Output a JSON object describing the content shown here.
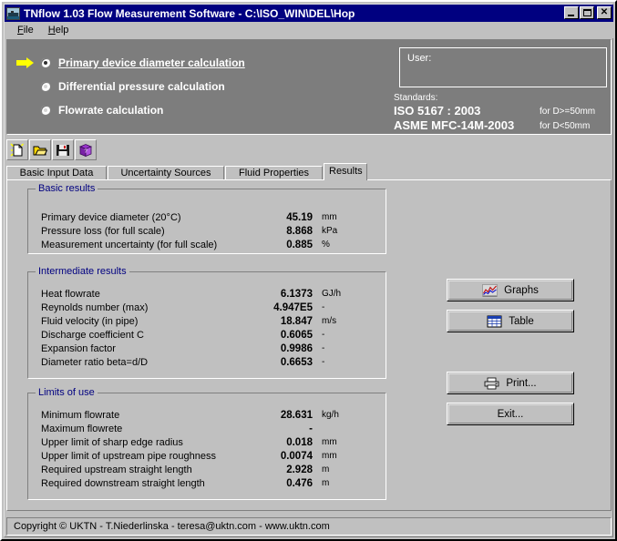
{
  "window": {
    "title": "TNflow 1.03 Flow Measurement Software - C:\\ISO_WIN\\DEL\\Hop",
    "icon": "app-boat-icon",
    "buttons": {
      "minimize": "_",
      "maximize": "□",
      "close": "✕"
    }
  },
  "menu": {
    "items": [
      {
        "label": "File",
        "accel": "F"
      },
      {
        "label": "Help",
        "accel": "H"
      }
    ]
  },
  "header": {
    "calc_modes": [
      {
        "label": "Primary device diameter calculation",
        "selected": true
      },
      {
        "label": "Differential pressure calculation",
        "selected": false
      },
      {
        "label": "Flowrate calculation",
        "selected": false
      }
    ],
    "user_label": "User:",
    "user_value": "",
    "standards_label": "Standards:",
    "standards": [
      {
        "name": "ISO 5167 : 2003",
        "note": "for D>=50mm"
      },
      {
        "name": "ASME  MFC-14M-2003",
        "note": "for D<50mm"
      }
    ]
  },
  "toolbar": {
    "buttons": [
      {
        "name": "new-document-icon",
        "tooltip": "New"
      },
      {
        "name": "open-folder-icon",
        "tooltip": "Open"
      },
      {
        "name": "save-floppy-icon",
        "tooltip": "Save"
      },
      {
        "name": "help-book-icon",
        "tooltip": "Help"
      }
    ]
  },
  "tabs": {
    "items": [
      {
        "label": "Basic Input Data",
        "active": false
      },
      {
        "label": "Uncertainty Sources",
        "active": false
      },
      {
        "label": "Fluid Properties",
        "active": false
      },
      {
        "label": "Results",
        "active": true
      }
    ]
  },
  "results": {
    "basic": {
      "legend": "Basic results",
      "rows": [
        {
          "label": "Primary device diameter (20°C)",
          "value": "45.19",
          "unit": "mm"
        },
        {
          "label": "Pressure loss (for full scale)",
          "value": "8.868",
          "unit": "kPa"
        },
        {
          "label": "Measurement uncertainty (for full scale)",
          "value": "0.885",
          "unit": "%"
        }
      ]
    },
    "intermediate": {
      "legend": "Intermediate results",
      "rows": [
        {
          "label": "Heat flowrate",
          "value": "6.1373",
          "unit": "GJ/h"
        },
        {
          "label": "Reynolds number (max)",
          "value": "4.947E5",
          "unit": "-"
        },
        {
          "label": "Fluid velocity (in pipe)",
          "value": "18.847",
          "unit": "m/s"
        },
        {
          "label": "Discharge coefficient C",
          "value": "0.6065",
          "unit": "-"
        },
        {
          "label": "Expansion factor",
          "value": "0.9986",
          "unit": "-"
        },
        {
          "label": "Diameter ratio beta=d/D",
          "value": "0.6653",
          "unit": "-"
        }
      ]
    },
    "limits": {
      "legend": "Limits of use",
      "rows": [
        {
          "label": "Minimum flowrate",
          "value": "28.631",
          "unit": "kg/h"
        },
        {
          "label": "Maximum flowrete",
          "value": "-",
          "unit": ""
        },
        {
          "label": "Upper limit of sharp edge radius",
          "value": "0.018",
          "unit": "mm"
        },
        {
          "label": "Upper limit of upstream pipe roughness",
          "value": "0.0074",
          "unit": "mm"
        },
        {
          "label": "Required upstream straight length",
          "value": "2.928",
          "unit": "m"
        },
        {
          "label": "Required downstream straight length",
          "value": "0.476",
          "unit": "m"
        }
      ]
    }
  },
  "side_buttons": {
    "graphs": "Graphs",
    "table": "Table",
    "print": "Print...",
    "exit": "Exit..."
  },
  "statusbar": {
    "text": "Copyright © UKTN - T.Niederlinska - teresa@uktn.com - www.uktn.com"
  },
  "colors": {
    "titlebar": "#000080",
    "face": "#c0c0c0",
    "header_panel": "#7d7d7d",
    "legend": "#000080",
    "arrow": "#ffff00"
  }
}
